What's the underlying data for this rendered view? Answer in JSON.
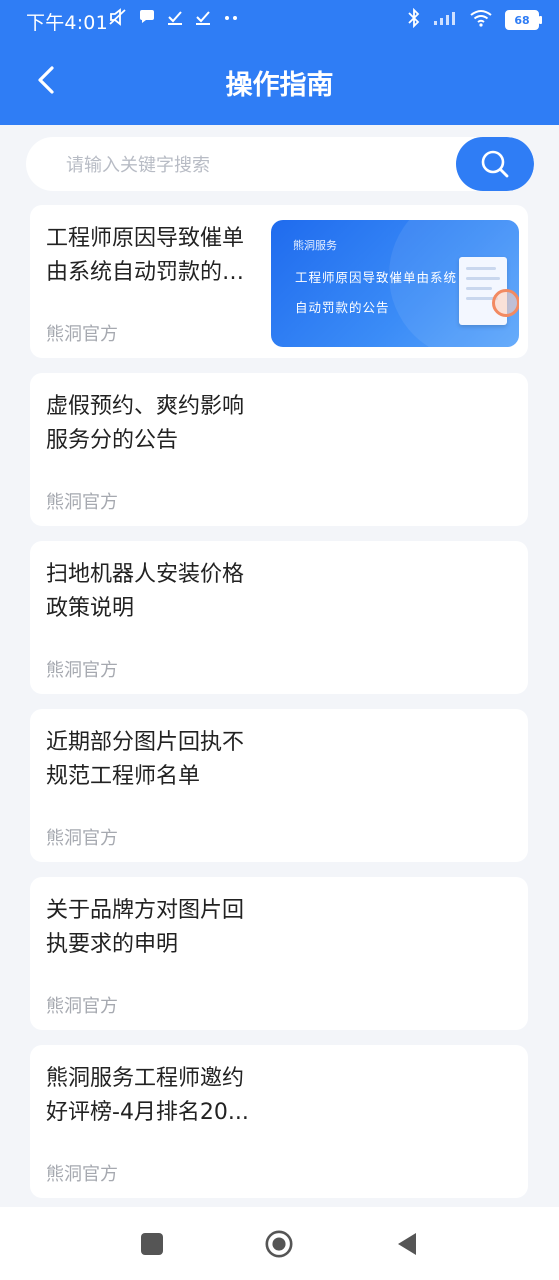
{
  "status_bar": {
    "time": "下午4:01",
    "battery": "68"
  },
  "header": {
    "title": "操作指南"
  },
  "search": {
    "placeholder": "请输入关键字搜索"
  },
  "articles": [
    {
      "title": "工程师原因导致催单由系统自动罚款的公告",
      "source": "熊洞官方",
      "thumbnail": {
        "brand": "熊洞服务",
        "text": "工程师原因导致催单由系统自动罚款的公告"
      }
    },
    {
      "title": "虚假预约、爽约影响服务分的公告",
      "source": "熊洞官方"
    },
    {
      "title": "扫地机器人安装价格政策说明",
      "source": "熊洞官方"
    },
    {
      "title": "近期部分图片回执不规范工程师名单",
      "source": "熊洞官方"
    },
    {
      "title": "关于品牌方对图片回执要求的申明",
      "source": "熊洞官方"
    },
    {
      "title": "熊洞服务工程师邀约好评榜-4月排名20...",
      "source": "熊洞官方"
    }
  ],
  "icons": {
    "back": "chevron-left-icon",
    "search": "search-icon",
    "nav": [
      "square-icon",
      "circle-icon",
      "triangle-back-icon"
    ]
  },
  "colors": {
    "accent": "#2f7df5",
    "background": "#f3f5f9",
    "source_text": "#a6a9b0"
  }
}
